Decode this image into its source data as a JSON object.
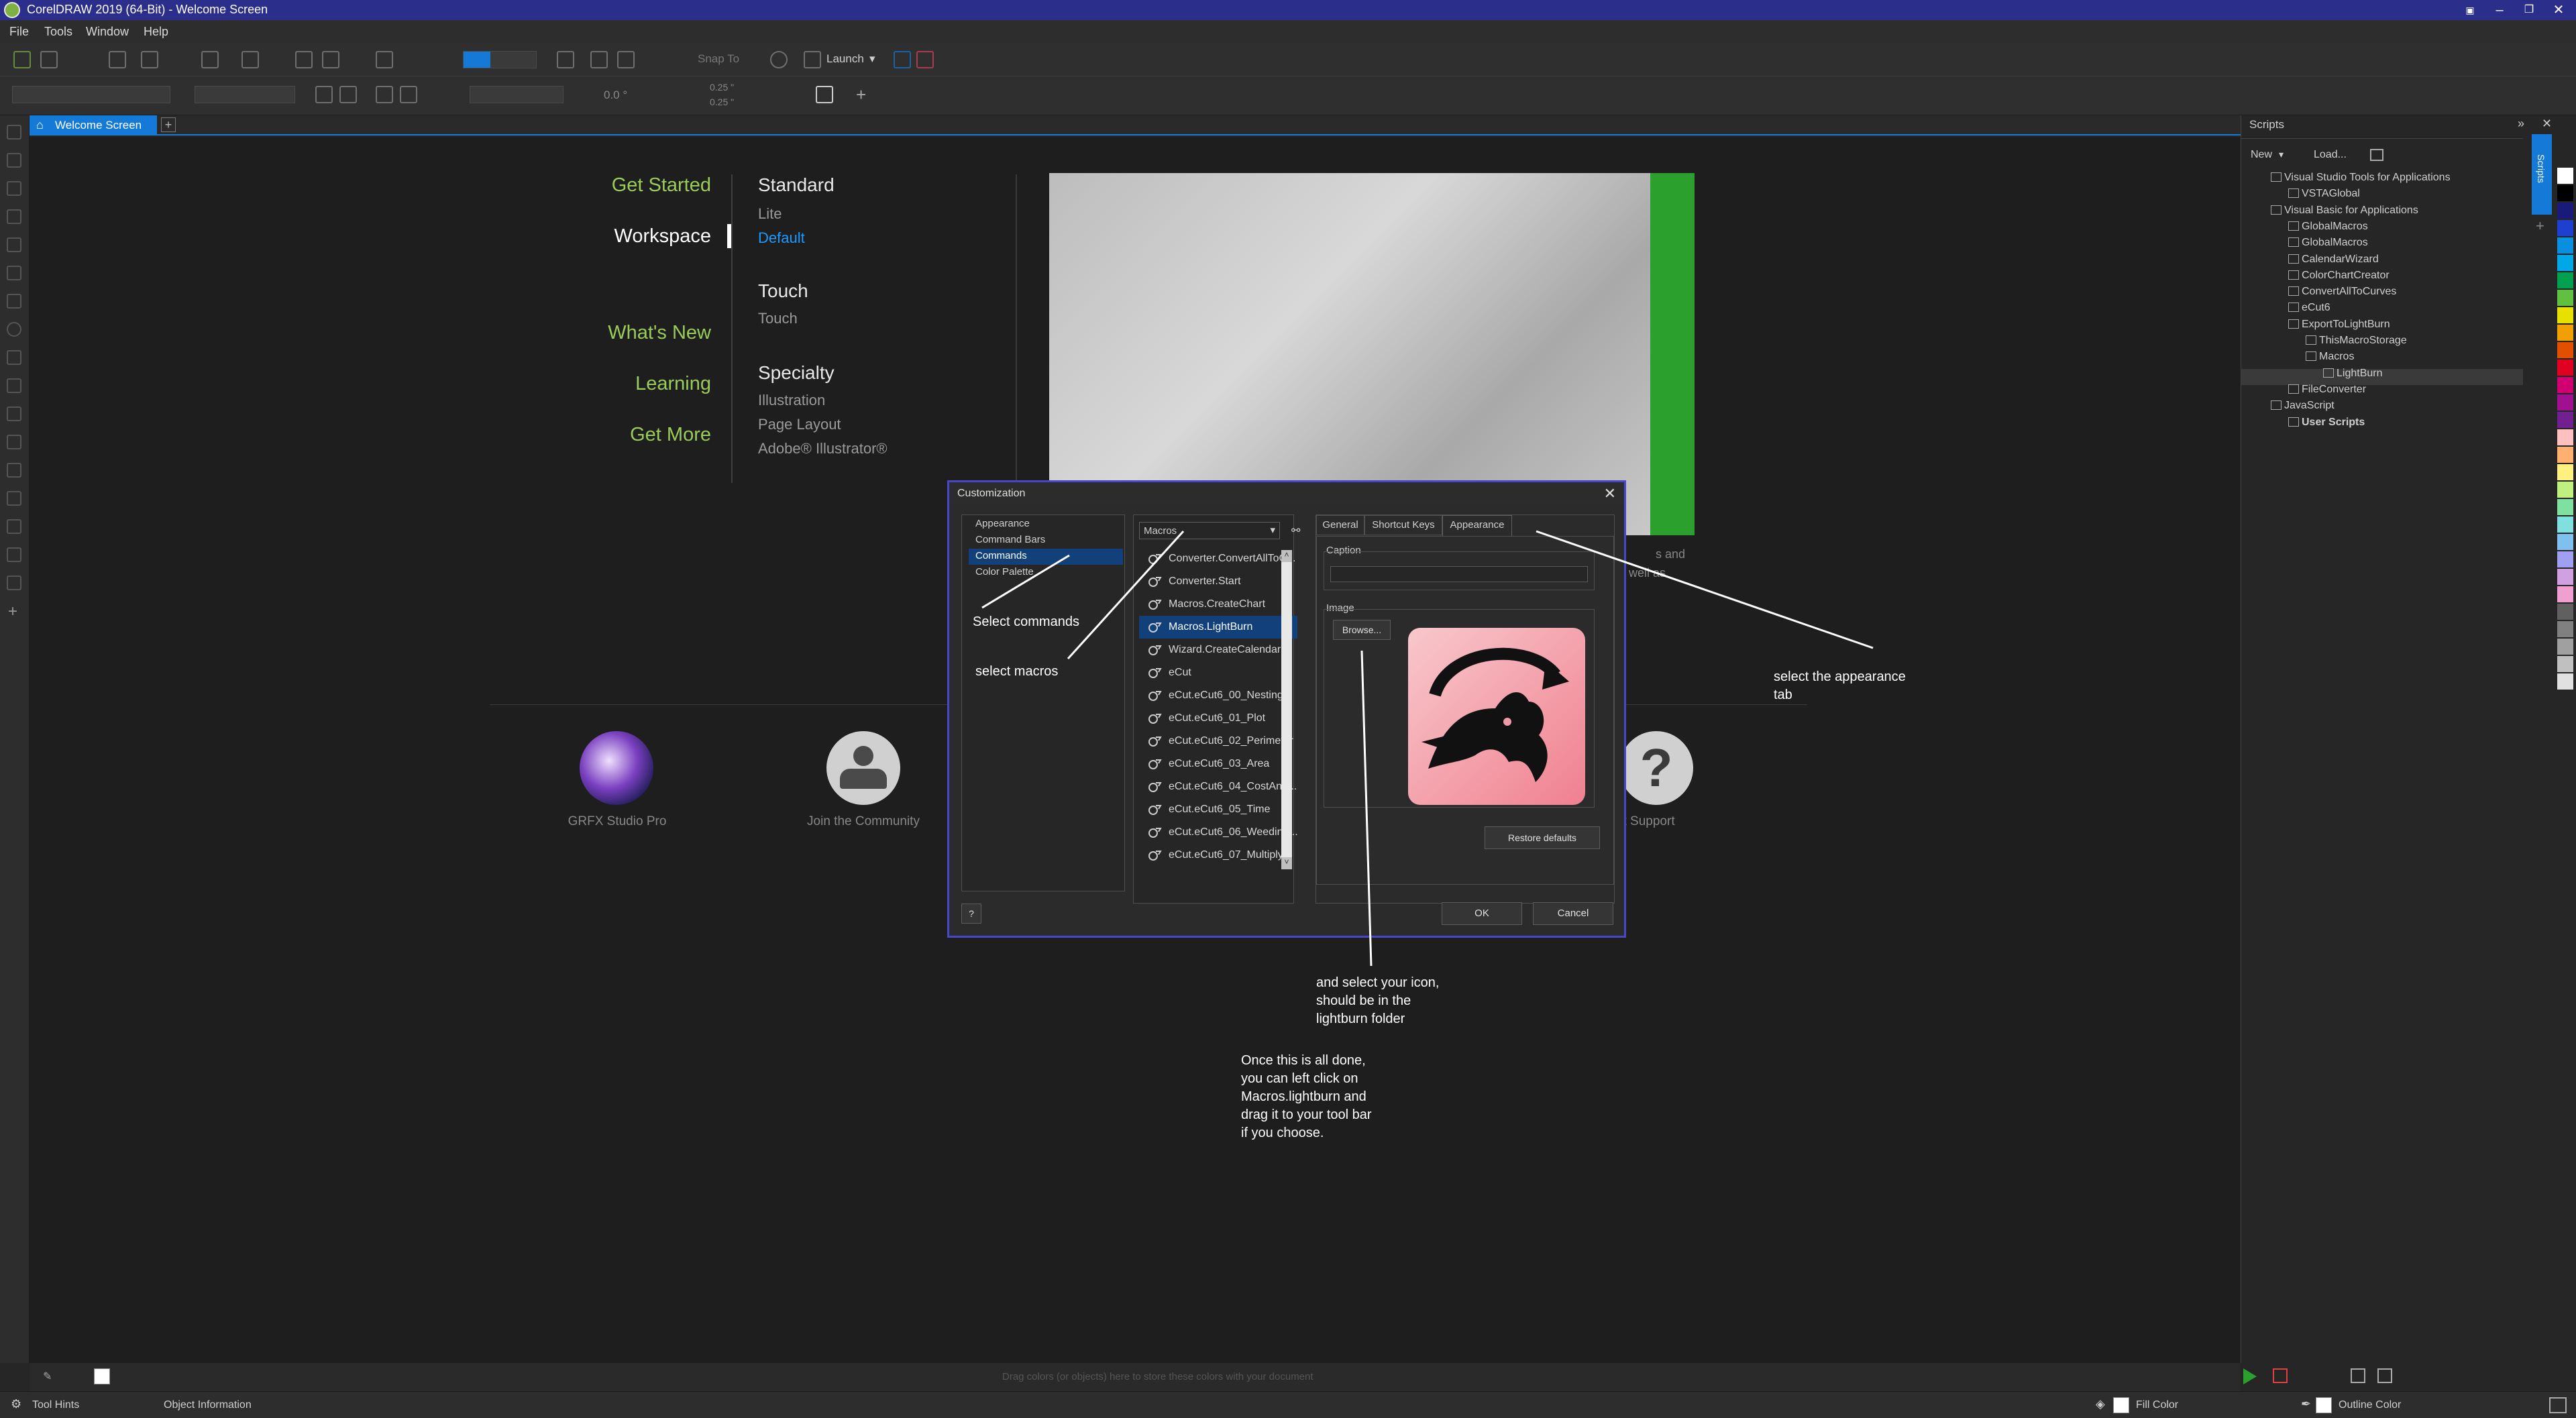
{
  "window": {
    "title": "CorelDRAW 2019 (64-Bit) - Welcome Screen"
  },
  "menu": [
    "File",
    "Tools",
    "Window",
    "Help"
  ],
  "toolbar": {
    "launch_label": "Launch",
    "snap_label": "Snap To",
    "angle_value": "0.0 °",
    "nudge_top": "0.25 \"",
    "nudge_bottom": "0.25 \""
  },
  "tabs": {
    "welcome": "Welcome Screen"
  },
  "welcome": {
    "nav": [
      "Get Started",
      "Workspace",
      "What's New",
      "Learning",
      "Get More"
    ],
    "workspaces": [
      {
        "name": "Standard",
        "items": [
          "Lite",
          "Default"
        ]
      },
      {
        "name": "Touch",
        "items": [
          "Touch"
        ]
      },
      {
        "name": "Specialty",
        "items": [
          "Illustration",
          "Page Layout",
          "Adobe® Illustrator®"
        ]
      }
    ],
    "active_item": "Default",
    "links": [
      "GRFX Studio Pro",
      "Join the Community",
      "ct Support"
    ],
    "partial_text": [
      "s and",
      "well as"
    ]
  },
  "dialog": {
    "title": "Customization",
    "tree": [
      "Appearance",
      "Command Bars",
      "Commands",
      "Color Palette"
    ],
    "selected_tree": "Commands",
    "dropdown_value": "Macros",
    "commands": [
      "Converter.ConvertAllToC...",
      "Converter.Start",
      "Macros.CreateChart",
      "Macros.LightBurn",
      "Wizard.CreateCalendar",
      "eCut",
      "eCut.eCut6_00_Nesting",
      "eCut.eCut6_01_Plot",
      "eCut.eCut6_02_Perimeter",
      "eCut.eCut6_03_Area",
      "eCut.eCut6_04_CostAnd...",
      "eCut.eCut6_05_Time",
      "eCut.eCut6_06_Weeding...",
      "eCut.eCut6_07_Multiply"
    ],
    "selected_command": "Macros.LightBurn",
    "tabs": [
      "General",
      "Shortcut Keys",
      "Appearance"
    ],
    "caption_label": "Caption",
    "image_label": "Image",
    "browse_label": "Browse...",
    "restore_label": "Restore defaults",
    "ok_label": "OK",
    "cancel_label": "Cancel",
    "help_label": "?"
  },
  "scripts_panel": {
    "title": "Scripts",
    "new_label": "New",
    "load_label": "Load...",
    "side_tab": "Scripts",
    "tree": [
      {
        "label": "Visual Studio Tools for Applications",
        "level": 0
      },
      {
        "label": "VSTAGlobal",
        "level": 1
      },
      {
        "label": "Visual Basic for Applications",
        "level": 0
      },
      {
        "label": "GlobalMacros",
        "level": 1
      },
      {
        "label": "GlobalMacros",
        "level": 1
      },
      {
        "label": "CalendarWizard",
        "level": 1
      },
      {
        "label": "ColorChartCreator",
        "level": 1
      },
      {
        "label": "ConvertAllToCurves",
        "level": 1
      },
      {
        "label": "eCut6",
        "level": 1
      },
      {
        "label": "ExportToLightBurn",
        "level": 1
      },
      {
        "label": "ThisMacroStorage",
        "level": 2
      },
      {
        "label": "Macros",
        "level": 2
      },
      {
        "label": "LightBurn",
        "level": 3
      },
      {
        "label": "FileConverter",
        "level": 1
      },
      {
        "label": "JavaScript",
        "level": 0
      },
      {
        "label": "User Scripts",
        "level": 1
      }
    ]
  },
  "status": {
    "tool_hints": "Tool Hints",
    "object_info": "Object Information",
    "fill": "Fill Color",
    "outline": "Outline Color",
    "drag_hint": "Drag colors (or objects) here to store these colors with your document"
  },
  "annotations": {
    "select_commands": "Select commands",
    "select_macros": "select macros",
    "appearance_tab": [
      "select the appearance",
      "tab"
    ],
    "select_icon": [
      "and select your icon,",
      "should be in the",
      "lightburn folder"
    ],
    "final": [
      "Once this is all done,",
      "you can left click on",
      "Macros.lightburn and",
      "drag it to your tool bar",
      "if you choose."
    ]
  },
  "colors": {
    "accent_blue": "#1479d7",
    "title_bar": "#2b2e8a",
    "nav_green": "#9acc5a",
    "dialog_border": "#4a46c8",
    "palette": [
      "#ffffff",
      "#000000",
      "#1a1a7a",
      "#1f3fd0",
      "#0a8fe0",
      "#00a8e8",
      "#00a050",
      "#60c040",
      "#e8e000",
      "#f0a000",
      "#e05000",
      "#e00020",
      "#d00070",
      "#a01090",
      "#702090",
      "#ffc0c0",
      "#ffb070",
      "#fff080",
      "#c0f080",
      "#80e0a0",
      "#80e0e0",
      "#80c0f0",
      "#a0a0f0",
      "#d0a0e0",
      "#f0a0d0",
      "#606060",
      "#808080",
      "#a0a0a0",
      "#c0c0c0",
      "#e0e0e0"
    ]
  },
  "icons": {
    "dragon": "lightburn-dragon-icon",
    "search": "binoculars-icon"
  }
}
